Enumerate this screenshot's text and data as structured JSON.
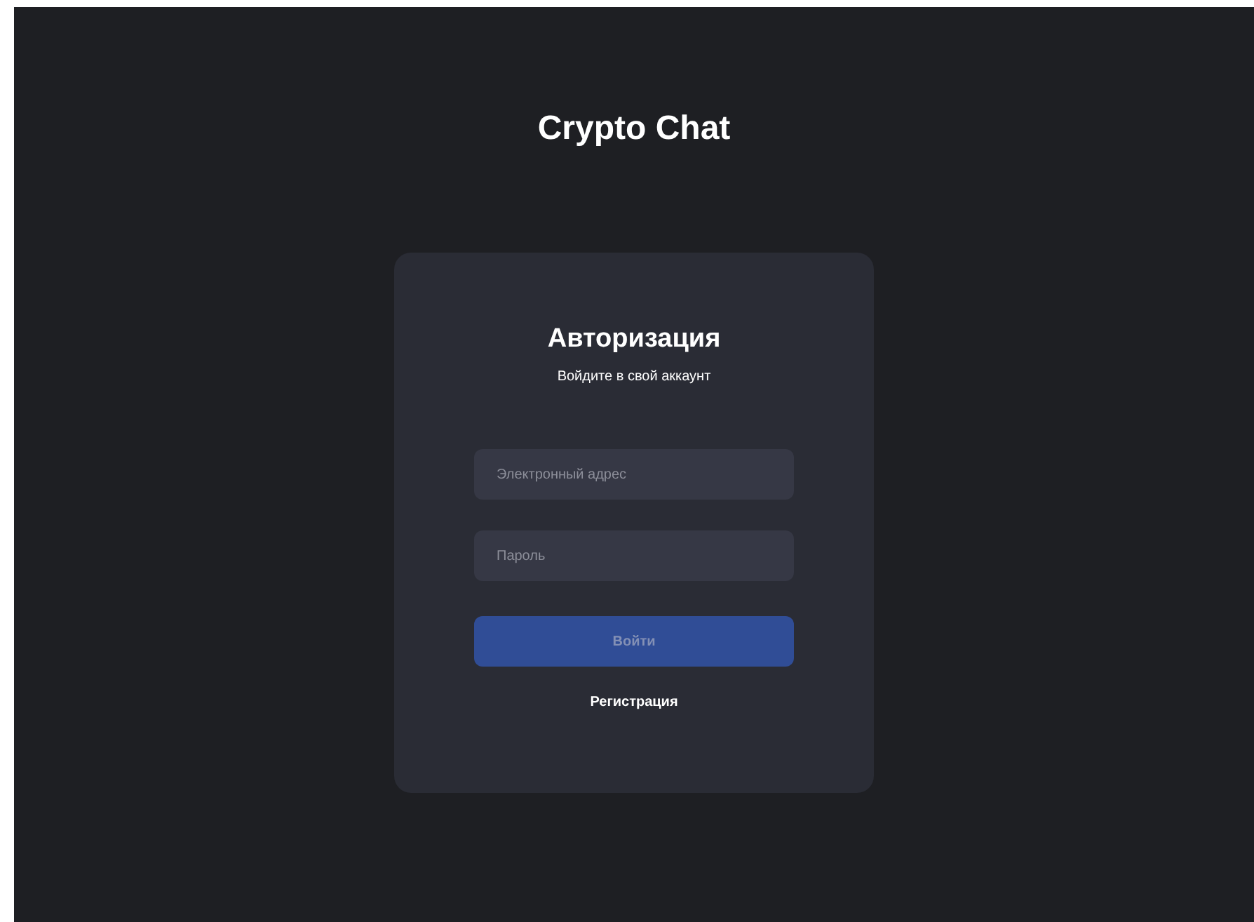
{
  "app_title": "Crypto Chat",
  "login_card": {
    "title": "Авторизация",
    "subtitle": "Войдите в свой аккаунт",
    "fields": [
      {
        "placeholder": "Электронный адрес"
      },
      {
        "placeholder": "Пароль"
      }
    ],
    "submit_button": {
      "label": "Войти",
      "disabled": true
    },
    "register_link": "Регистрация"
  }
}
